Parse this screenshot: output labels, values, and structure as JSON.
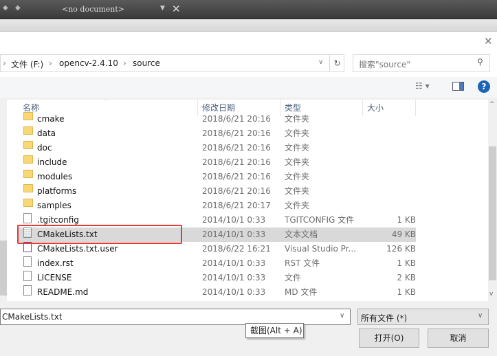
{
  "editor_bar": {
    "document": "<no document>"
  },
  "address": {
    "crumbs": [
      "文件 (F:)",
      "opencv-2.4.10",
      "source"
    ]
  },
  "search": {
    "placeholder": "搜索\"source\""
  },
  "columns": [
    "名称",
    "修改日期",
    "类型",
    "大小"
  ],
  "files": [
    {
      "name": "cmake",
      "date": "2018/6/21 20:16",
      "type": "文件夹",
      "size": "",
      "icon": "folder"
    },
    {
      "name": "data",
      "date": "2018/6/21 20:16",
      "type": "文件夹",
      "size": "",
      "icon": "folder"
    },
    {
      "name": "doc",
      "date": "2018/6/21 20:16",
      "type": "文件夹",
      "size": "",
      "icon": "folder"
    },
    {
      "name": "include",
      "date": "2018/6/21 20:16",
      "type": "文件夹",
      "size": "",
      "icon": "folder"
    },
    {
      "name": "modules",
      "date": "2018/6/21 20:16",
      "type": "文件夹",
      "size": "",
      "icon": "folder"
    },
    {
      "name": "platforms",
      "date": "2018/6/21 20:16",
      "type": "文件夹",
      "size": "",
      "icon": "folder"
    },
    {
      "name": "samples",
      "date": "2018/6/21 20:17",
      "type": "文件夹",
      "size": "",
      "icon": "folder"
    },
    {
      "name": ".tgitconfig",
      "date": "2014/10/1 0:33",
      "type": "TGITCONFIG 文件",
      "size": "1 KB",
      "icon": "file"
    },
    {
      "name": "CMakeLists.txt",
      "date": "2014/10/1 0:33",
      "type": "文本文档",
      "size": "49 KB",
      "icon": "text-file",
      "selected": true
    },
    {
      "name": "CMakeLists.txt.user",
      "date": "2018/6/22 16:21",
      "type": "Visual Studio Pr...",
      "size": "126 KB",
      "icon": "vs-file"
    },
    {
      "name": "index.rst",
      "date": "2014/10/1 0:33",
      "type": "RST 文件",
      "size": "1 KB",
      "icon": "file"
    },
    {
      "name": "LICENSE",
      "date": "2014/10/1 0:33",
      "type": "文件",
      "size": "2 KB",
      "icon": "file"
    },
    {
      "name": "README.md",
      "date": "2014/10/1 0:33",
      "type": "MD 文件",
      "size": "1 KB",
      "icon": "file"
    }
  ],
  "filename": {
    "value": "CMakeLists.txt"
  },
  "filter": {
    "value": "所有文件 (*)"
  },
  "buttons": {
    "open": "打开(O)",
    "cancel": "取消"
  },
  "tooltip": "截图(Alt + A)",
  "colors": {
    "highlight": "#d9d9d9",
    "annotation": "#e53935"
  }
}
